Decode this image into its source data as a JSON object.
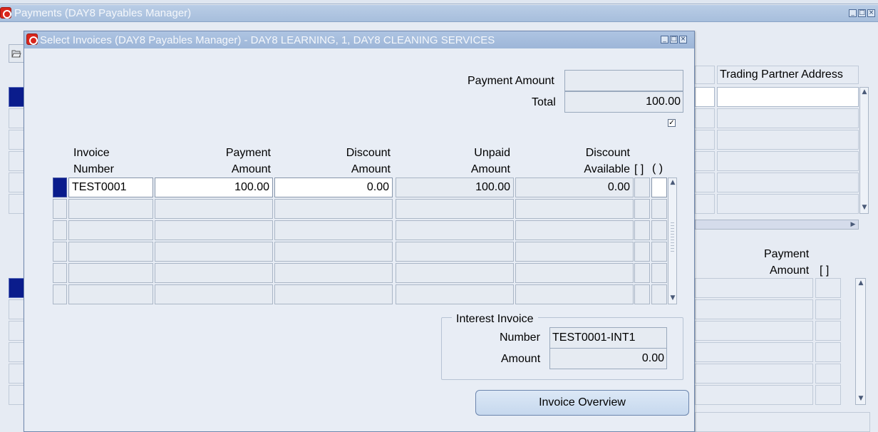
{
  "background_window": {
    "title": "Payments (DAY8 Payables Manager)",
    "column_trading_partner_address": "Trading Partner Address",
    "lower_col_payment": "Payment",
    "lower_col_amount": "Amount",
    "lower_col_bracket": "[ ]"
  },
  "dialog": {
    "title": "Select Invoices (DAY8 Payables Manager) - DAY8 LEARNING, 1, DAY8 CLEANING SERVICES",
    "payment_amount_label": "Payment Amount",
    "payment_amount_value": "",
    "total_label": "Total",
    "total_value": "100.00",
    "check_mark": "✓",
    "table": {
      "headers": {
        "invoice_number": [
          "Invoice",
          "Number"
        ],
        "payment_amount": [
          "Payment",
          "Amount"
        ],
        "discount_amount": [
          "Discount",
          "Amount"
        ],
        "unpaid_amount": [
          "Unpaid",
          "Amount"
        ],
        "discount_available": [
          "Discount",
          "Available"
        ],
        "bracket": "[ ]",
        "paren": "( )"
      },
      "rows": [
        {
          "invoice_number": "TEST0001",
          "payment_amount": "100.00",
          "discount_amount": "0.00",
          "unpaid_amount": "100.00",
          "discount_available": "0.00"
        },
        {
          "invoice_number": "",
          "payment_amount": "",
          "discount_amount": "",
          "unpaid_amount": "",
          "discount_available": ""
        },
        {
          "invoice_number": "",
          "payment_amount": "",
          "discount_amount": "",
          "unpaid_amount": "",
          "discount_available": ""
        },
        {
          "invoice_number": "",
          "payment_amount": "",
          "discount_amount": "",
          "unpaid_amount": "",
          "discount_available": ""
        },
        {
          "invoice_number": "",
          "payment_amount": "",
          "discount_amount": "",
          "unpaid_amount": "",
          "discount_available": ""
        },
        {
          "invoice_number": "",
          "payment_amount": "",
          "discount_amount": "",
          "unpaid_amount": "",
          "discount_available": ""
        }
      ]
    },
    "interest_invoice": {
      "legend": "Interest Invoice",
      "number_label": "Number",
      "number_value": "TEST0001-INT1",
      "amount_label": "Amount",
      "amount_value": "0.00"
    },
    "overview_button": "Invoice Overview"
  },
  "window_buttons": {
    "minimize": "_",
    "maximize": "□",
    "close": "×"
  },
  "icons": {
    "oracle": "oracle-icon",
    "folder": "open-folder-icon"
  },
  "colors": {
    "row_selected": "#0a1c8c",
    "title_bar": "#a7bedc",
    "background": "#e6ebf3"
  }
}
